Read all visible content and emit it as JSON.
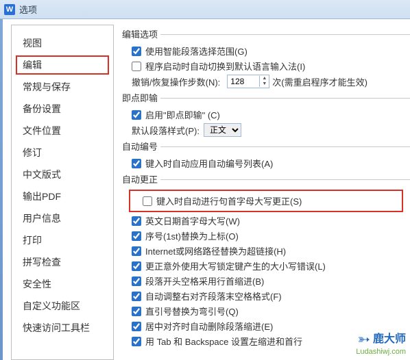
{
  "titlebar": {
    "icon": "W",
    "title": "选项"
  },
  "sidebar": {
    "items": [
      {
        "label": "视图"
      },
      {
        "label": "编辑",
        "highlight": true
      },
      {
        "label": "常规与保存"
      },
      {
        "label": "备份设置"
      },
      {
        "label": "文件位置"
      },
      {
        "label": "修订"
      },
      {
        "label": "中文版式"
      },
      {
        "label": "输出PDF"
      },
      {
        "label": "用户信息"
      },
      {
        "label": "打印"
      },
      {
        "label": "拼写检查"
      },
      {
        "label": "安全性"
      },
      {
        "label": "自定义功能区"
      },
      {
        "label": "快速访问工具栏"
      }
    ]
  },
  "groups": {
    "edit_options": {
      "title": "编辑选项",
      "smart_para": {
        "label": "使用智能段落选择范围(G)",
        "checked": true
      },
      "default_ime": {
        "label": "程序启动时自动切换到默认语言输入法(I)",
        "checked": false
      },
      "undo_label_left": "撤销/恢复操作步数(N):",
      "undo_value": "128",
      "undo_label_right": "次(需重启程序才能生效)"
    },
    "click_type": {
      "title": "即点即输",
      "enable": {
        "label": "启用\"即点即输\" (C)",
        "checked": true
      },
      "para_style_label": "默认段落样式(P):",
      "para_style_value": "正文"
    },
    "auto_number": {
      "title": "自动编号",
      "apply_list": {
        "label": "键入时自动应用自动编号列表(A)",
        "checked": true
      }
    },
    "auto_correct": {
      "title": "自动更正",
      "items": [
        {
          "label": "键入时自动进行句首字母大写更正(S)",
          "checked": false,
          "highlight": true
        },
        {
          "label": "英文日期首字母大写(W)",
          "checked": true
        },
        {
          "label": "序号(1st)替换为上标(O)",
          "checked": true
        },
        {
          "label": "Internet或网络路径替换为超链接(H)",
          "checked": true
        },
        {
          "label": "更正意外使用大写锁定键产生的大小写错误(L)",
          "checked": true
        },
        {
          "label": "段落开头空格采用行首缩进(B)",
          "checked": true
        },
        {
          "label": "自动调整右对齐段落末空格格式(F)",
          "checked": true
        },
        {
          "label": "直引号替换为弯引号(Q)",
          "checked": true
        },
        {
          "label": "居中对齐时自动删除段落缩进(E)",
          "checked": true
        },
        {
          "label": "用 Tab 和 Backspace 设置左缩进和首行",
          "checked": true
        }
      ]
    }
  },
  "logo": {
    "brand": "鹿大师",
    "url": "Ludashiwj.com"
  }
}
